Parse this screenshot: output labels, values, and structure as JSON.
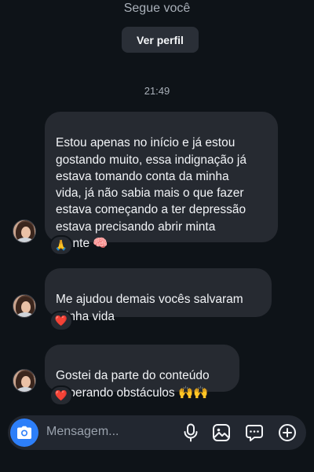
{
  "header": {
    "follows_text": "Segue você",
    "view_profile_label": "Ver perfil"
  },
  "timestamp": "21:49",
  "messages": [
    {
      "text": "Estou apenas no início e já estou\ngostando muito, essa indignação já\nestava tomando conta da minha\nvida, já não sabia mais o que fazer\nestava começando a ter depressão\nestava precisando abrir minta\nmente 🧠",
      "reaction": "🙏"
    },
    {
      "text": "Me ajudou demais vocês salvaram\nminha vida",
      "reaction": "❤️"
    },
    {
      "text": "Gostei da parte do conteúdo\nsuperando obstáculos 🙌🙌",
      "reaction": "❤️"
    }
  ],
  "composer": {
    "placeholder": "Mensagem...",
    "icons": [
      "camera-icon",
      "microphone-icon",
      "image-icon",
      "sticker-icon",
      "plus-icon"
    ]
  },
  "colors": {
    "background": "#0e1318",
    "bubble": "#262a31",
    "accent": "#2d7ff9"
  }
}
